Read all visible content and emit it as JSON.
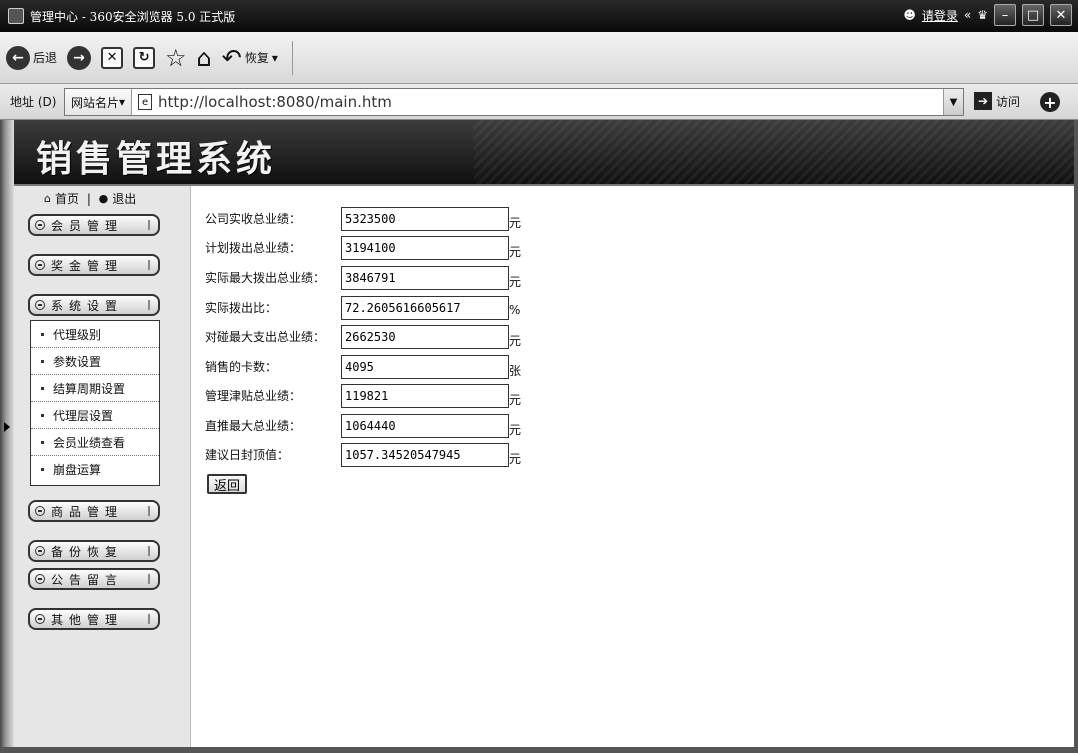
{
  "window": {
    "title": "管理中心 - 360安全浏览器 5.0 正式版",
    "login": "请登录",
    "min_label": "–",
    "max_label": "□",
    "close_label": "✕"
  },
  "toolbar": {
    "back_label": "后退",
    "restore_label": "恢复"
  },
  "address": {
    "label": "地址 (D)",
    "site_names": "网站名片",
    "url": "http://localhost:8080/main.htm",
    "go_label": "访问"
  },
  "banner": {
    "title": "销售管理系统"
  },
  "sidebar": {
    "home": "首页",
    "logout": "退出",
    "menus": {
      "member": "会员管理",
      "bonus": "奖金管理",
      "system": "系统设置",
      "product": "商品管理",
      "backup": "备份恢复",
      "notice": "公告留言",
      "other": "其他管理"
    },
    "submenu": [
      "代理级别",
      "参数设置",
      "结算周期设置",
      "代理层设置",
      "会员业绩查看",
      "崩盘运算"
    ]
  },
  "form": {
    "rows": [
      {
        "label": "公司实收总业绩：",
        "value": "5323500",
        "unit": "元"
      },
      {
        "label": "计划拨出总业绩：",
        "value": "3194100",
        "unit": "元"
      },
      {
        "label": "实际最大拨出总业绩：",
        "value": "3846791",
        "unit": "元"
      },
      {
        "label": "实际拨出比：",
        "value": "72.2605616605617",
        "unit": "%"
      },
      {
        "label": "对碰最大支出总业绩：",
        "value": "2662530",
        "unit": "元"
      },
      {
        "label": "销售的卡数：",
        "value": "4095",
        "unit": "张"
      },
      {
        "label": "管理津贴总业绩：",
        "value": "119821",
        "unit": "元"
      },
      {
        "label": "直推最大总业绩：",
        "value": "1064440",
        "unit": "元"
      },
      {
        "label": "建议日封顶值：",
        "value": "1057.34520547945",
        "unit": "元"
      }
    ],
    "back_label": "返回"
  }
}
